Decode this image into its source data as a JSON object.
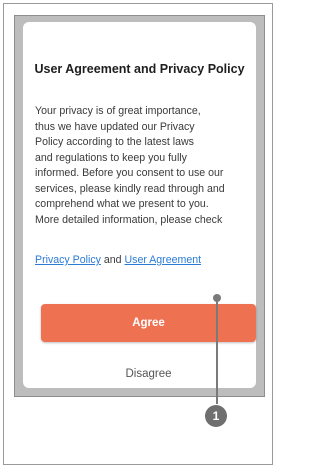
{
  "dialog": {
    "title": "User Agreement and Privacy Policy",
    "body_lines": [
      "Your privacy is of great importance,",
      "thus we have updated our Privacy",
      "Policy according to the latest laws",
      "and regulations to keep you fully",
      "informed. Before you consent to use our",
      "services, please kindly read through and",
      "comprehend what we present to you.",
      " More detailed information, please check"
    ],
    "privacy_link": "Privacy Policy",
    "link_joiner": " and ",
    "agreement_link": "User Agreement",
    "agree_label": "Agree",
    "disagree_label": "Disagree"
  },
  "annotation": {
    "step_number": "1"
  },
  "colors": {
    "agree_button": "#ee7252",
    "link": "#2a7bd6",
    "screen_background": "#bdbdbd"
  }
}
